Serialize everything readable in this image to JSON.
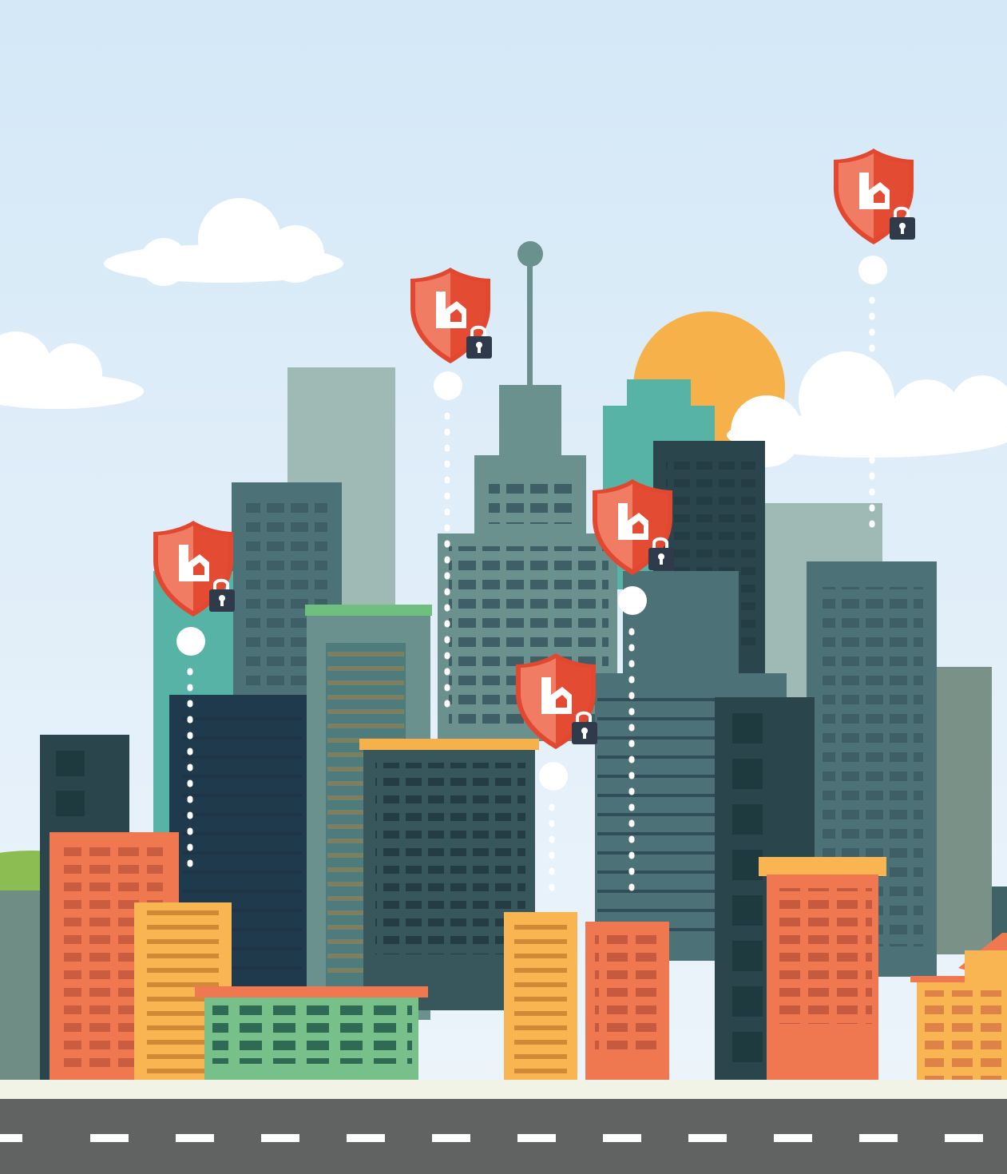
{
  "scene": {
    "description_hidden": "",
    "colors": {
      "sky_top": "#d4e8f7",
      "sky_bottom": "#eef5fb",
      "cloud": "#ffffff",
      "sun": "#f6b14b",
      "hill": "#8bbd52",
      "road": "#616262",
      "sidewalk": "#f1f3e6",
      "lane_mark": "#ffffff",
      "shield_light": "#ef7c63",
      "shield_dark": "#e44b33",
      "shield_border": "#e2472f",
      "lock": "#2f3b4a",
      "dot": "#ffffff"
    },
    "icons": [
      "shield-lock-icon",
      "padlock-icon",
      "house-b-logo"
    ],
    "security_markers": [
      {
        "id": "marker-1"
      },
      {
        "id": "marker-2"
      },
      {
        "id": "marker-3"
      },
      {
        "id": "marker-4"
      },
      {
        "id": "marker-5"
      }
    ]
  }
}
